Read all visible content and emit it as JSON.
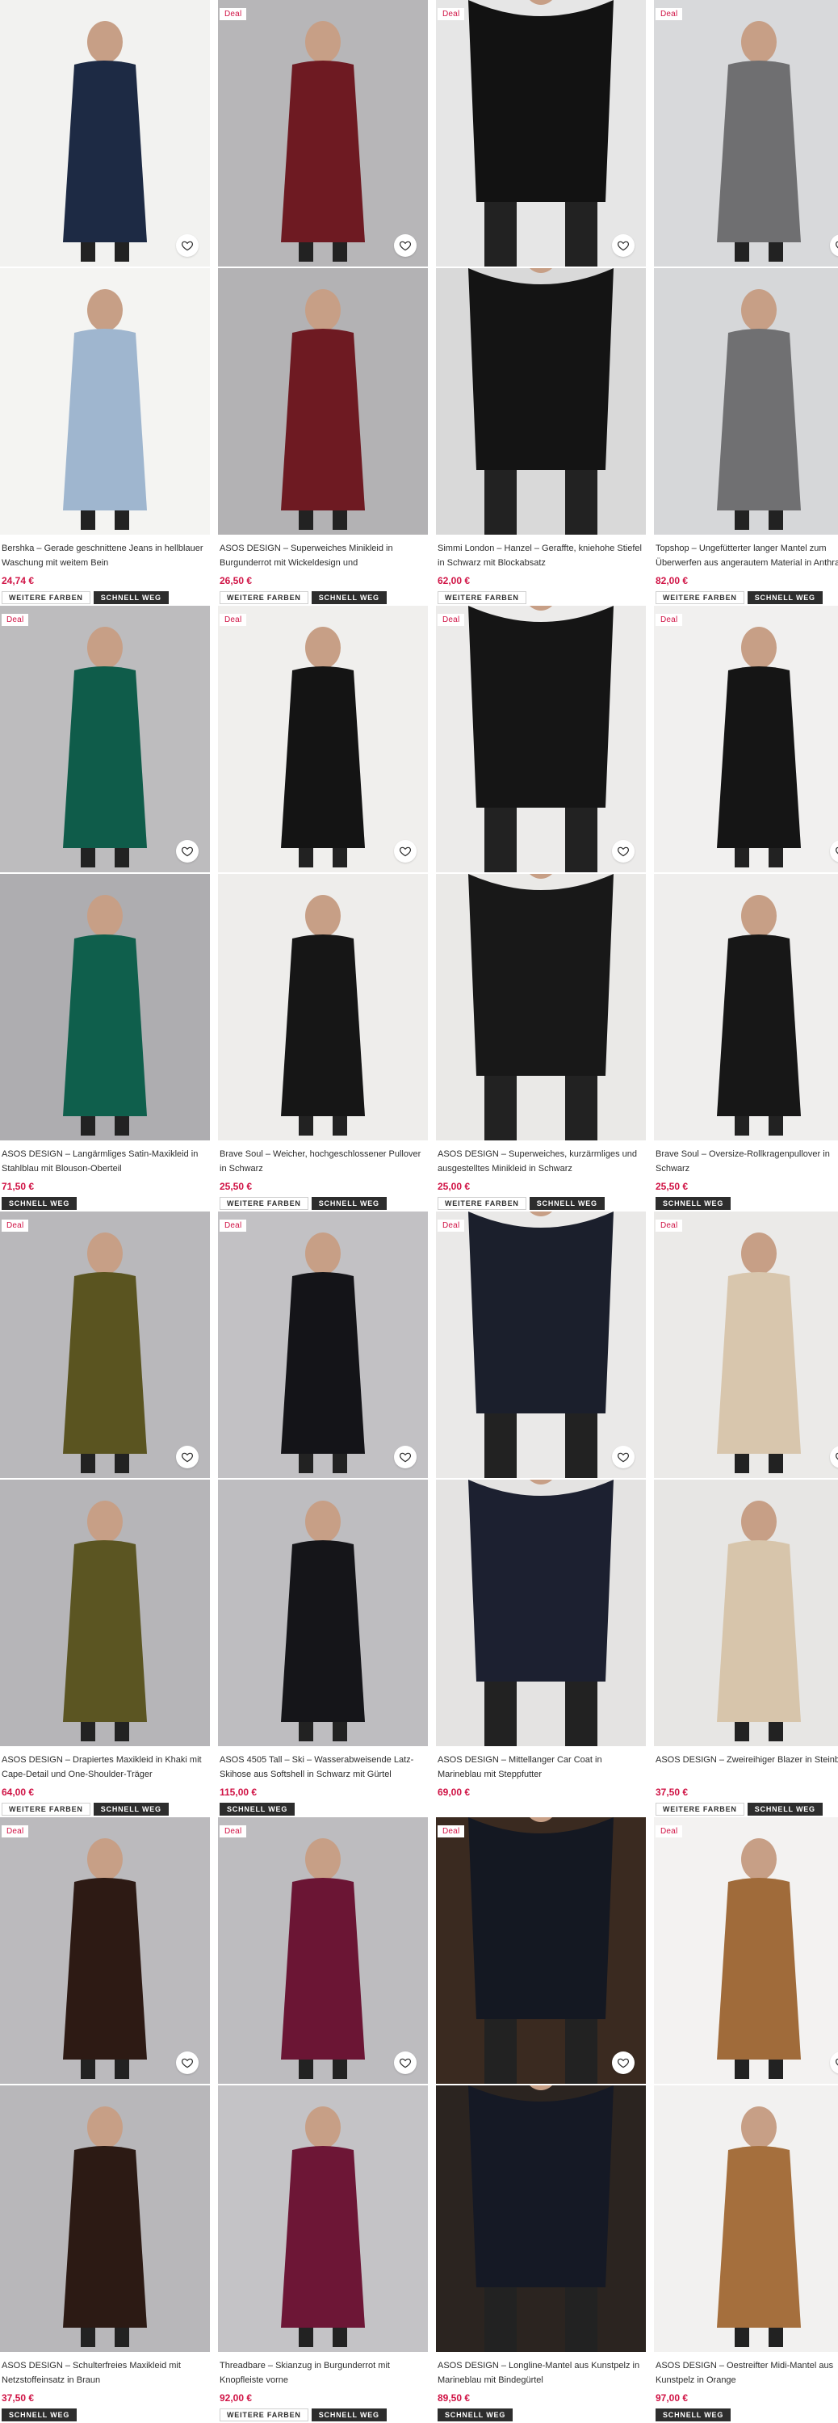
{
  "labels": {
    "deal": "Deal",
    "more_colors": "WEITERE FARBEN",
    "sell_fast": "SCHNELL WEG"
  },
  "colors": {
    "price": "#d01345",
    "tag_dark": "#2d2d2d"
  },
  "products": [
    {
      "title": "Bershka – Gerade geschnittene Jeans in hellblauer Waschung mit weitem Bein",
      "price": "24,74 €",
      "deal": false,
      "tags": [
        "more_colors",
        "sell_fast"
      ],
      "bg1": "#f2f2f0",
      "bg2": "#f4f4f2",
      "fg1": "#1d2a44",
      "fg2": "#9fb6cf"
    },
    {
      "title": "ASOS DESIGN – Superweiches Minikleid in Burgunderrot mit Wickeldesign und asymmetrische...",
      "price": "26,50 €",
      "deal": true,
      "tags": [
        "more_colors",
        "sell_fast"
      ],
      "bg1": "#b7b6b8",
      "bg2": "#b3b2b4",
      "fg1": "#6e1a22",
      "fg2": "#6e1a22"
    },
    {
      "title": "Simmi London – Hanzel – Geraffte, kniehohe Stiefel in Schwarz mit Blockabsatz",
      "price": "62,00 €",
      "deal": true,
      "tags": [
        "more_colors"
      ],
      "bg1": "#e6e6e6",
      "bg2": "#d9d9d9",
      "fg1": "#121212",
      "fg2": "#141414"
    },
    {
      "title": "Topshop – Ungefütterter langer Mantel zum Überwerfen aus angerautem Material in Anthrazit",
      "price": "82,00 €",
      "deal": true,
      "tags": [
        "more_colors",
        "sell_fast"
      ],
      "bg1": "#d8d9db",
      "bg2": "#d6d7d9",
      "fg1": "#6f6f71",
      "fg2": "#707072"
    },
    {
      "title": "ASOS DESIGN – Langärmliges Satin-Maxikleid in Stahlblau mit Blouson-Oberteil",
      "price": "71,50 €",
      "deal": true,
      "tags": [
        "sell_fast"
      ],
      "bg1": "#bdbcbe",
      "bg2": "#aeadb0",
      "fg1": "#0f5c4a",
      "fg2": "#0f5f4c"
    },
    {
      "title": "Brave Soul – Weicher, hochgeschlossener Pullover in Schwarz",
      "price": "25,50 €",
      "deal": true,
      "tags": [
        "more_colors",
        "sell_fast"
      ],
      "bg1": "#f0efed",
      "bg2": "#eeedeb",
      "fg1": "#141414",
      "fg2": "#161616"
    },
    {
      "title": "ASOS DESIGN – Superweiches, kurzärmliges und ausgestelltes Minikleid in Schwarz",
      "price": "25,00 €",
      "deal": true,
      "tags": [
        "more_colors",
        "sell_fast"
      ],
      "bg1": "#ecebea",
      "bg2": "#eae9e7",
      "fg1": "#151515",
      "fg2": "#181818"
    },
    {
      "title": "Brave Soul – Oversize-Rollkragenpullover in Schwarz",
      "price": "25,50 €",
      "deal": true,
      "tags": [
        "sell_fast"
      ],
      "bg1": "#f1f0ef",
      "bg2": "#efeeed",
      "fg1": "#151515",
      "fg2": "#171717"
    },
    {
      "title": "ASOS DESIGN – Drapiertes Maxikleid in Khaki mit Cape-Detail und One-Shoulder-Träger",
      "price": "64,00 €",
      "deal": true,
      "tags": [
        "more_colors",
        "sell_fast"
      ],
      "bg1": "#b9b8bb",
      "bg2": "#b6b5b8",
      "fg1": "#5a5420",
      "fg2": "#5b5522"
    },
    {
      "title": "ASOS 4505 Tall – Ski – Wasserabweisende Latz-Skihose aus Softshell in Schwarz mit Gürtel",
      "price": "115,00 €",
      "deal": true,
      "tags": [
        "sell_fast"
      ],
      "bg1": "#c2c1c4",
      "bg2": "#bebdc0",
      "fg1": "#141418",
      "fg2": "#151519"
    },
    {
      "title": "ASOS DESIGN – Mittellanger Car Coat in Marineblau mit Steppfutter",
      "price": "69,00 €",
      "deal": true,
      "tags": [],
      "bg1": "#eae9e8",
      "bg2": "#e4e3e2",
      "fg1": "#1b1f2c",
      "fg2": "#1c2030"
    },
    {
      "title": "ASOS DESIGN – Zweireihiger Blazer in Steinbeige",
      "price": "37,50 €",
      "deal": true,
      "tags": [
        "more_colors",
        "sell_fast"
      ],
      "bg1": "#ebeae8",
      "bg2": "#e7e6e4",
      "fg1": "#d8c6ad",
      "fg2": "#d7c5ab"
    },
    {
      "title": "ASOS DESIGN – Schulterfreies Maxikleid mit Netzstoffeinsatz in Braun",
      "price": "37,50 €",
      "deal": true,
      "tags": [
        "sell_fast"
      ],
      "bg1": "#bbbabd",
      "bg2": "#b8b7ba",
      "fg1": "#2d1a14",
      "fg2": "#2c1a14"
    },
    {
      "title": "Threadbare – Skianzug in Burgunderrot mit Knopfleiste vorne",
      "price": "92,00 €",
      "deal": true,
      "tags": [
        "more_colors",
        "sell_fast"
      ],
      "bg1": "#bdbcbf",
      "bg2": "#c4c3c6",
      "fg1": "#6b1534",
      "fg2": "#6d1636"
    },
    {
      "title": "ASOS DESIGN – Longline-Mantel aus Kunstpelz in Marineblau mit Bindegürtel",
      "price": "89,50 €",
      "deal": true,
      "tags": [
        "sell_fast"
      ],
      "bg1": "#3a2a20",
      "bg2": "#2b2420",
      "fg1": "#141822",
      "fg2": "#151925"
    },
    {
      "title": "ASOS DESIGN – Oestreifter Midi-Mantel aus Kunstpelz in Orange",
      "price": "97,00 €",
      "deal": true,
      "tags": [
        "sell_fast"
      ],
      "bg1": "#f3f2f1",
      "bg2": "#f2f1f0",
      "fg1": "#a06b3a",
      "fg2": "#a56f3d"
    }
  ]
}
